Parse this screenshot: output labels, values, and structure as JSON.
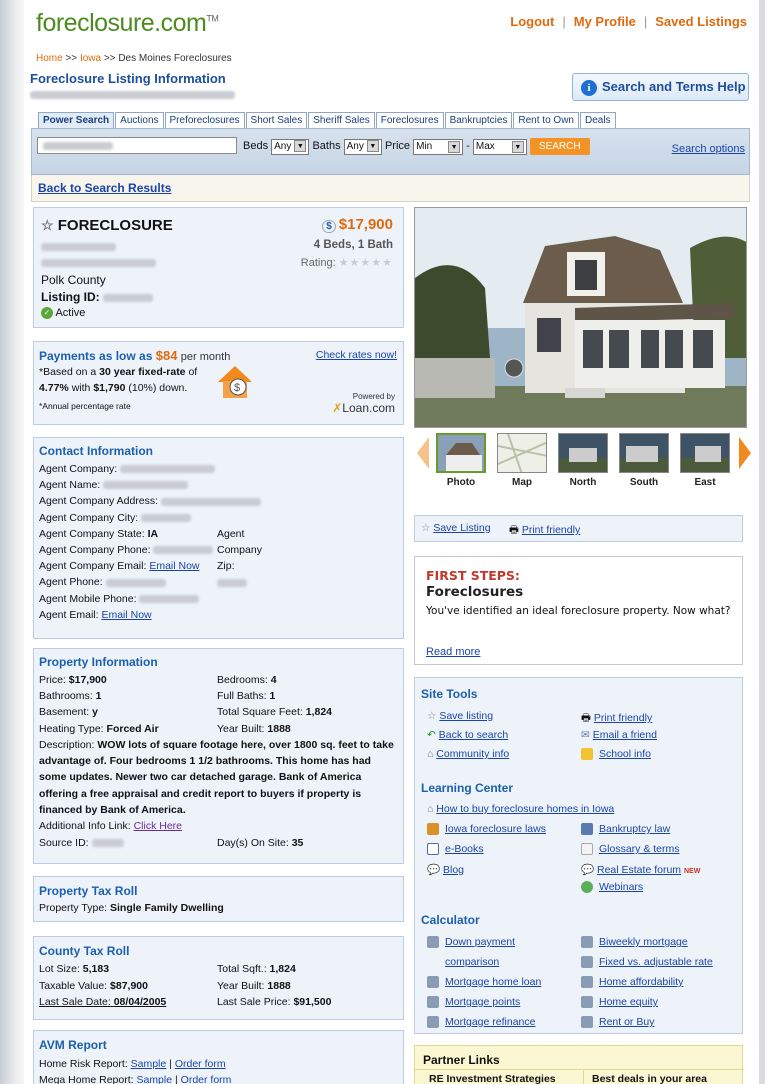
{
  "header": {
    "logo": "foreclosure.com",
    "trademark": "TM",
    "nav": [
      "Logout",
      "My Profile",
      "Saved Listings"
    ]
  },
  "breadcrumb": {
    "home": "Home",
    "sep1": ">>",
    "state": "Iowa",
    "sep2": ">>",
    "city": "Des Moines Foreclosures"
  },
  "page_title": "Foreclosure Listing Information",
  "help_button": "Search and Terms Help",
  "tabs": [
    "Power Search",
    "Auctions",
    "Preforeclosures",
    "Short Sales",
    "Sheriff Sales",
    "Foreclosures",
    "Bankruptcies",
    "Rent to Own",
    "Deals"
  ],
  "search": {
    "beds_label": "Beds",
    "beds_value": "Any",
    "baths_label": "Baths",
    "baths_value": "Any",
    "price_label": "Price",
    "price_min": "Min",
    "dash": "-",
    "price_max": "Max",
    "button": "SEARCH",
    "options_link": "Search options"
  },
  "back_link": "Back to Search Results",
  "listing": {
    "type": "FORECLOSURE",
    "price": "$17,900",
    "beds_baths": "4 Beds, 1 Bath",
    "rating_label": "Rating:",
    "county": "Polk County",
    "listing_id_label": "Listing ID:",
    "status": "Active"
  },
  "payments": {
    "prefix": "Payments as low as",
    "amount": "$84",
    "suffix": "per month",
    "check_link": "Check rates now!",
    "line1a": "*Based on a",
    "line1b": "30 year fixed-rate",
    "line1c": "of",
    "line2a": "4.77%",
    "line2b": "with",
    "line2c": "$1,790",
    "line2d": "(10%) down.",
    "note": "*Annual percentage rate",
    "powered_by": "Powered by",
    "brand": "Loan.com"
  },
  "contact": {
    "title": "Contact Information",
    "labels": [
      "Agent Company:",
      "Agent Name:",
      "Agent Company Address:",
      "Agent Company City:",
      "Agent Company State:",
      "Agent Company Phone:",
      "Agent Company Email:",
      "Agent Phone:",
      "Agent Mobile Phone:",
      "Agent Email:"
    ],
    "state_value": "IA",
    "zip_label": "Agent Company Zip:",
    "email_link": "Email Now"
  },
  "property": {
    "title": "Property Information",
    "price_label": "Price:",
    "price": "$17,900",
    "bedrooms_label": "Bedrooms:",
    "bedrooms": "4",
    "bathrooms_label": "Bathrooms:",
    "bathrooms": "1",
    "fullbaths_label": "Full Baths:",
    "fullbaths": "1",
    "basement_label": "Basement:",
    "basement": "y",
    "sqft_label": "Total Square Feet:",
    "sqft": "1,824",
    "heating_label": "Heating Type:",
    "heating": "Forced Air",
    "yearbuilt_label": "Year Built:",
    "yearbuilt": "1888",
    "desc_label": "Description:",
    "description": "WOW lots of square footage here, over 1800 sq. feet to take advantage of. Four bedrooms 1 1/2 bathrooms. This home has had some updates. Newer two car detached garage. Bank of America offering a free appraisal and credit report to buyers if property is financed by Bank of America.",
    "addl_label": "Additional Info Link:",
    "addl_link": "Click Here",
    "source_label": "Source ID:",
    "days_label": "Day(s) On Site:",
    "days": "35"
  },
  "tax_roll": {
    "title": "Property Tax Roll",
    "type_label": "Property Type:",
    "type": "Single Family Dwelling"
  },
  "county_tax": {
    "title": "County Tax Roll",
    "lot_label": "Lot Size:",
    "lot": "5,183",
    "sqft_label": "Total Sqft.:",
    "sqft": "1,824",
    "taxable_label": "Taxable Value:",
    "taxable": "$87,900",
    "year_label": "Year Built:",
    "year": "1888",
    "lastdate_label": "Last Sale Date:",
    "lastdate": "08/04/2005",
    "lastprice_label": "Last Sale Price:",
    "lastprice": "$91,500"
  },
  "avm": {
    "title": "AVM Report",
    "r1_label": "Home Risk Report:",
    "r2_label": "Mega Home Report:",
    "sample": "Sample",
    "sep": "|",
    "order": "Order form"
  },
  "photos": [
    "Photo",
    "Map",
    "North",
    "South",
    "East"
  ],
  "actions": {
    "save": "Save Listing",
    "print": "Print friendly"
  },
  "first_steps": {
    "title": "FIRST STEPS:",
    "subtitle": "Foreclosures",
    "text": "You've identified an ideal foreclosure property. Now what?",
    "link": "Read more"
  },
  "site_tools": {
    "title": "Site Tools",
    "items": [
      "Save listing",
      "Print friendly",
      "Back to search",
      "Email a friend",
      "Community info",
      "School info"
    ]
  },
  "learning": {
    "title": "Learning Center",
    "items": [
      "How to buy foreclosure homes in Iowa",
      "Iowa foreclosure laws",
      "Bankruptcy law",
      "e-Books",
      "Glossary & terms",
      "Blog",
      "Real Estate forum",
      "Webinars"
    ],
    "new_badge": "NEW"
  },
  "calculator": {
    "title": "Calculator",
    "items": [
      "Down payment",
      "comparison",
      "Biweekly mortgage",
      "Fixed vs. adjustable rate",
      "Mortgage home loan",
      "Home affordability",
      "Mortgage points",
      "Home equity",
      "Mortgage refinance",
      "Rent or Buy"
    ]
  },
  "partners": {
    "title": "Partner Links",
    "col1": "RE Investment Strategies",
    "col2": "Best deals in your area"
  },
  "colors": {
    "brand_green": "#4c8c1e",
    "accent_orange": "#e06a10",
    "link_blue": "#1a45a8",
    "heading_blue": "#1c5fae"
  }
}
